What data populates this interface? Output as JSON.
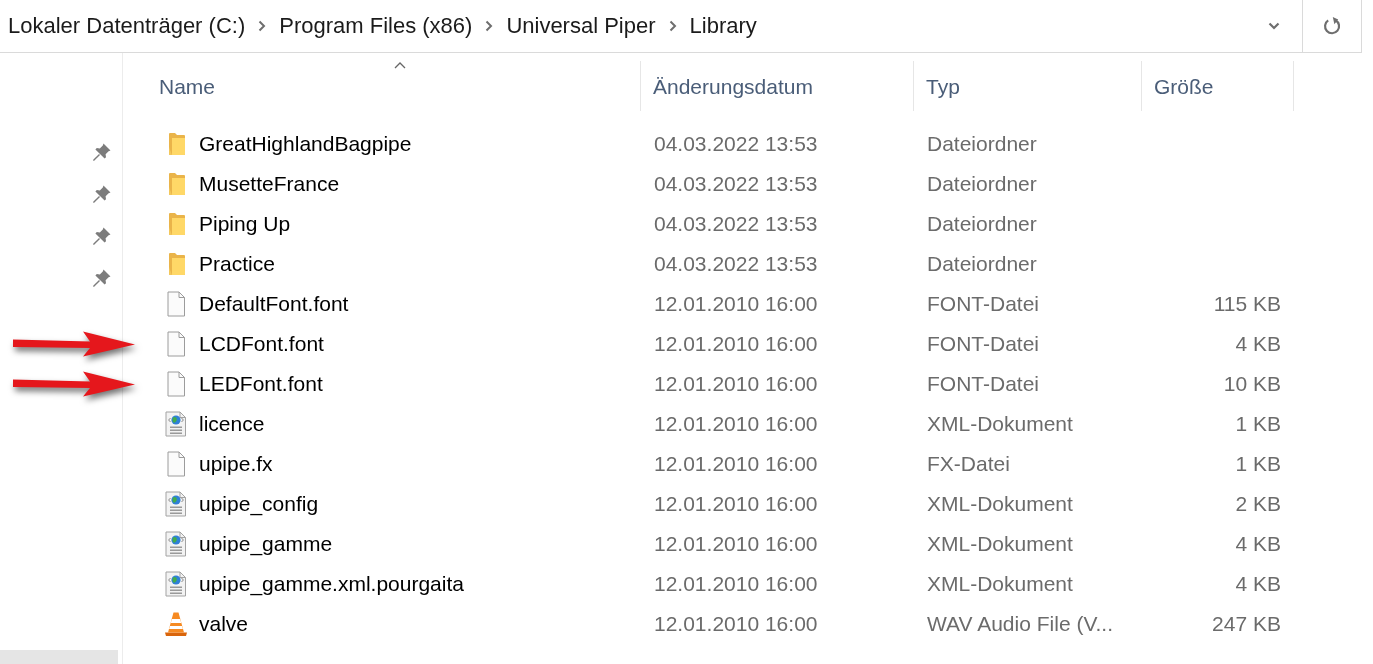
{
  "address_bar": {
    "breadcrumbs": [
      "Lokaler Datenträger (C:)",
      "Program Files (x86)",
      "Universal Piper",
      "Library"
    ]
  },
  "nav_pane": {
    "items": [
      {
        "pinned": true,
        "selected": false
      },
      {
        "pinned": true,
        "selected": false
      },
      {
        "pinned": true,
        "selected": false
      },
      {
        "pinned": true,
        "selected": false
      },
      {
        "pinned": false,
        "selected": true
      }
    ]
  },
  "file_list": {
    "columns": [
      {
        "label": "Name",
        "sorted": true
      },
      {
        "label": "Änderungsdatum",
        "sorted": false
      },
      {
        "label": "Typ",
        "sorted": false
      },
      {
        "label": "Größe",
        "sorted": false
      }
    ],
    "rows": [
      {
        "kind": "folder",
        "name": "GreatHighlandBagpipe",
        "modified": "04.03.2022 13:53",
        "type": "Dateiordner",
        "marked": false
      },
      {
        "kind": "folder",
        "name": "MusetteFrance",
        "modified": "04.03.2022 13:53",
        "type": "Dateiordner",
        "marked": false
      },
      {
        "kind": "folder",
        "name": "Piping Up",
        "modified": "04.03.2022 13:53",
        "type": "Dateiordner",
        "marked": false
      },
      {
        "kind": "folder",
        "name": "Practice",
        "modified": "04.03.2022 13:53",
        "type": "Dateiordner",
        "marked": false
      },
      {
        "kind": "file",
        "name": "DefaultFont.font",
        "modified": "12.01.2010 16:00",
        "type": "FONT-Datei",
        "size": "115 KB",
        "marked": false
      },
      {
        "kind": "file",
        "name": "LCDFont.font",
        "modified": "12.01.2010 16:00",
        "type": "FONT-Datei",
        "size": "4 KB",
        "marked": true
      },
      {
        "kind": "file",
        "name": "LEDFont.font",
        "modified": "12.01.2010 16:00",
        "type": "FONT-Datei",
        "size": "10 KB",
        "marked": true
      },
      {
        "kind": "xml",
        "name": "licence",
        "modified": "12.01.2010 16:00",
        "type": "XML-Dokument",
        "size": "1 KB",
        "marked": false
      },
      {
        "kind": "file",
        "name": "upipe.fx",
        "modified": "12.01.2010 16:00",
        "type": "FX-Datei",
        "size": "1 KB",
        "marked": false
      },
      {
        "kind": "xml",
        "name": "upipe_config",
        "modified": "12.01.2010 16:00",
        "type": "XML-Dokument",
        "size": "2 KB",
        "marked": false
      },
      {
        "kind": "xml",
        "name": "upipe_gamme",
        "modified": "12.01.2010 16:00",
        "type": "XML-Dokument",
        "size": "4 KB",
        "marked": false
      },
      {
        "kind": "xml",
        "name": "upipe_gamme.xml.pourgaita",
        "modified": "12.01.2010 16:00",
        "type": "XML-Dokument",
        "size": "4 KB",
        "marked": false
      },
      {
        "kind": "audio",
        "name": "valve",
        "modified": "12.01.2010 16:00",
        "type": "WAV Audio File (V...",
        "size": "247 KB",
        "marked": false
      }
    ]
  }
}
